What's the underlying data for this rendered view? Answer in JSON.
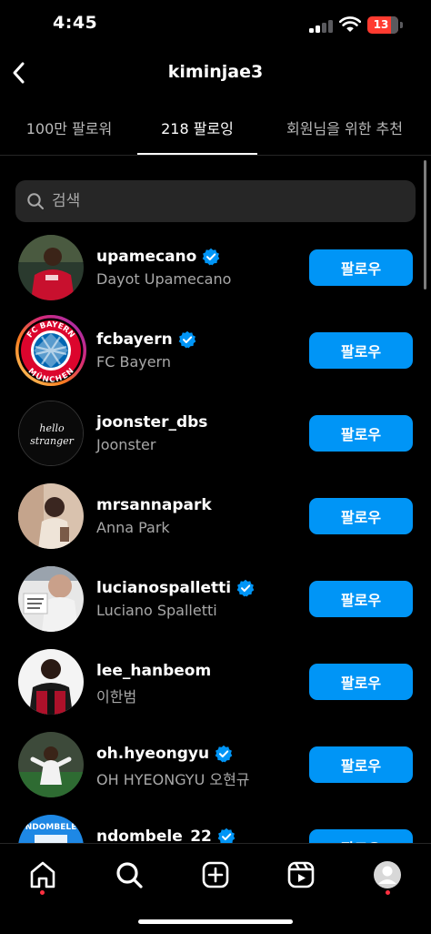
{
  "status_bar": {
    "time": "4:45",
    "battery_level": "13",
    "icons": [
      "signal-icon",
      "wifi-icon",
      "battery-icon"
    ],
    "battery_color": "#ff3b30"
  },
  "header": {
    "title": "kiminjae3",
    "back_icon": "chevron-left-icon"
  },
  "tabs": [
    {
      "label": "100만 팔로워",
      "active": false
    },
    {
      "label": "218 팔로잉",
      "active": true
    },
    {
      "label": "회원님을 위한 추천",
      "active": false
    }
  ],
  "search": {
    "placeholder": "검색",
    "value": "",
    "icon": "search-icon"
  },
  "following": [
    {
      "username": "upamecano",
      "name": "Dayot Upamecano",
      "verified": true,
      "button": "팔로우"
    },
    {
      "username": "fcbayern",
      "name": "FC Bayern",
      "verified": true,
      "button": "팔로우"
    },
    {
      "username": "joonster_dbs",
      "name": "Joonster",
      "verified": false,
      "button": "팔로우"
    },
    {
      "username": "mrsannapark",
      "name": "Anna Park",
      "verified": false,
      "button": "팔로우"
    },
    {
      "username": "lucianospalletti",
      "name": "Luciano Spalletti",
      "verified": true,
      "button": "팔로우"
    },
    {
      "username": "lee_hanbeom",
      "name": "이한범",
      "verified": false,
      "button": "팔로우"
    },
    {
      "username": "oh.hyeongyu",
      "name": "OH HYEONGYU 오현규",
      "verified": true,
      "button": "팔로우"
    },
    {
      "username": "ndombele_22",
      "name": "",
      "verified": true,
      "button": "팔로우"
    }
  ],
  "avatar_text": {
    "fcbayern_logo_top": "FC BAYERN",
    "fcbayern_logo_bottom": "MÜNCHEN",
    "joonster_neon_line1": "hello",
    "joonster_neon_line2": "stranger",
    "ndombele_jersey": "NDOMBELE"
  },
  "bottom_nav": {
    "items": [
      "home-icon",
      "search-icon",
      "create-icon",
      "reels-icon",
      "profile-avatar"
    ],
    "notification_dot_color": "#ff3040"
  },
  "colors": {
    "background": "#000000",
    "accent": "#0095f6",
    "verified": "#0095f6",
    "secondary_text": "#a8a8a8",
    "search_background": "#262626"
  }
}
